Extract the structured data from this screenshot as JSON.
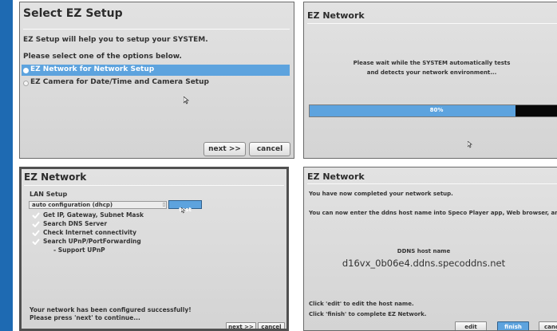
{
  "colors": {
    "accent_blue": "#5da3de",
    "left_bar": "#1e6ab2",
    "panel_bg": "#d8d8d8",
    "dark_border": "#6a6a6a"
  },
  "panel1": {
    "title": "Select EZ Setup",
    "intro": "EZ Setup will help you to setup your SYSTEM.",
    "prompt": "Please select one of the options below.",
    "options": [
      {
        "label": "EZ Network for Network Setup",
        "selected": true
      },
      {
        "label": "EZ Camera for Date/Time and Camera Setup",
        "selected": false
      }
    ],
    "next_label": "next >>",
    "cancel_label": "cancel"
  },
  "panel2": {
    "title": "EZ Network",
    "wait_line1": "Please wait while the SYSTEM automatically tests",
    "wait_line2": "and detects your network environment...",
    "progress_text": "80%",
    "progress_value": 0.8
  },
  "panel3": {
    "title": "EZ Network",
    "section_label": "LAN Setup",
    "mode_value": "auto configuration (dhcp)",
    "test_label": "test",
    "checks": [
      "Get IP, Gateway, Subnet Mask",
      "Search DNS Server",
      "Check Internet connectivity",
      "Search UPnP/PortForwarding"
    ],
    "sub_item": "- Support UPnP",
    "done_line1": "Your network has been configured successfully!",
    "done_line2": "Please press 'next' to continue...",
    "next_label": "next >>",
    "cancel_label": "cancel"
  },
  "panel4": {
    "title": "EZ Network",
    "completed": "You have now completed your network setup.",
    "enter_host": "You can now enter the ddns host name into Speco Player app, Web browser, and SecureGuar",
    "ddns_label": "DDNS host name",
    "ddns_value": "d16vx_0b06e4.ddns.specoddns.net",
    "edit_hint": "Click 'edit' to edit the host name.",
    "finish_hint": "Click 'finish' to complete EZ Network.",
    "edit_label": "edit",
    "finish_label": "finish",
    "cancel_label": "canc"
  }
}
